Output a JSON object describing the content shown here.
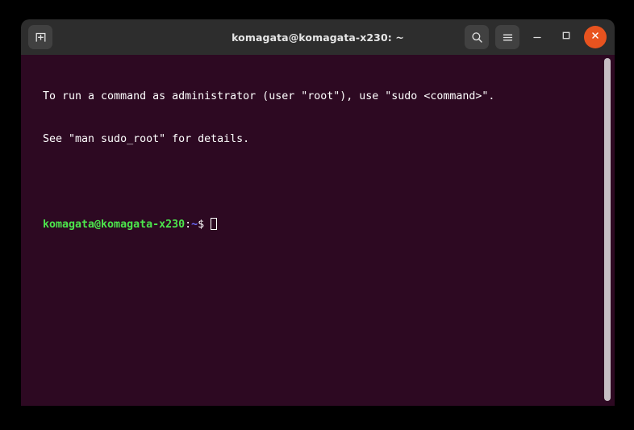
{
  "window": {
    "title": "komagata@komagata-x230: ~",
    "titlebar_color": "#2d2d2d",
    "terminal_bg": "#2d0922",
    "desktop_bg": "#000000"
  },
  "titlebar": {
    "new_tab_icon": "new-tab-icon",
    "new_tab_label": "New Tab",
    "search_icon": "search-icon",
    "search_label": "Search",
    "menu_icon": "hamburger-menu-icon",
    "menu_label": "Menu",
    "minimize_icon": "minimize-icon",
    "minimize_label": "Minimize",
    "maximize_icon": "maximize-icon",
    "maximize_label": "Maximize",
    "close_icon": "close-icon",
    "close_label": "Close",
    "close_color": "#e8531f"
  },
  "terminal": {
    "lines": [
      "To run a command as administrator (user \"root\"), use \"sudo <command>\".",
      "See \"man sudo_root\" for details."
    ],
    "prompt": {
      "user_host": "komagata@komagata-x230",
      "separator": ":",
      "path": "~",
      "symbol": "$",
      "command": "",
      "user_host_color": "#4ce64c",
      "path_color": "#6c6cff",
      "text_color": "#ffffff"
    },
    "cursor": "cursor-block"
  },
  "scrollbar": {
    "name": "vertical-scrollbar",
    "thumb_color": "#c6bfc4",
    "position_percent": 100
  }
}
